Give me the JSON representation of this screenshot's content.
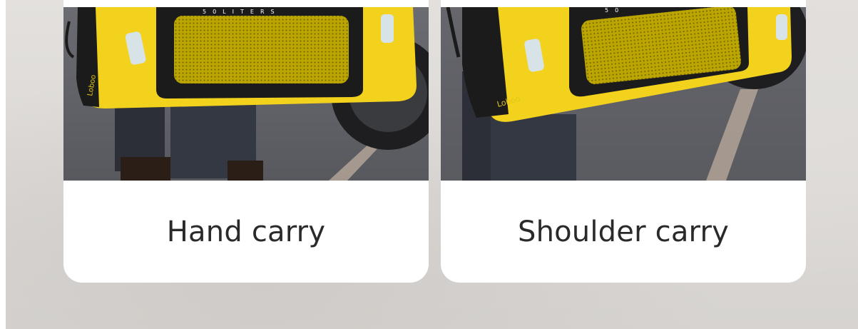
{
  "cards": [
    {
      "caption": "Hand carry",
      "bag_label": "50LITERS",
      "brand": "Loboo",
      "image_icon": "yellow-duffel-bag-photo"
    },
    {
      "caption": "Shoulder carry",
      "bag_label": "50",
      "brand": "Loboo",
      "image_icon": "yellow-duffel-bag-photo"
    }
  ],
  "colors": {
    "bag_yellow": "#f2d21c",
    "bag_black": "#1b1b1b",
    "mesh": "#b9a300",
    "asphalt": "#5c5d62",
    "card": "#ffffff",
    "backdrop": "#dedbd8",
    "caption_text": "#2a2a2a"
  }
}
